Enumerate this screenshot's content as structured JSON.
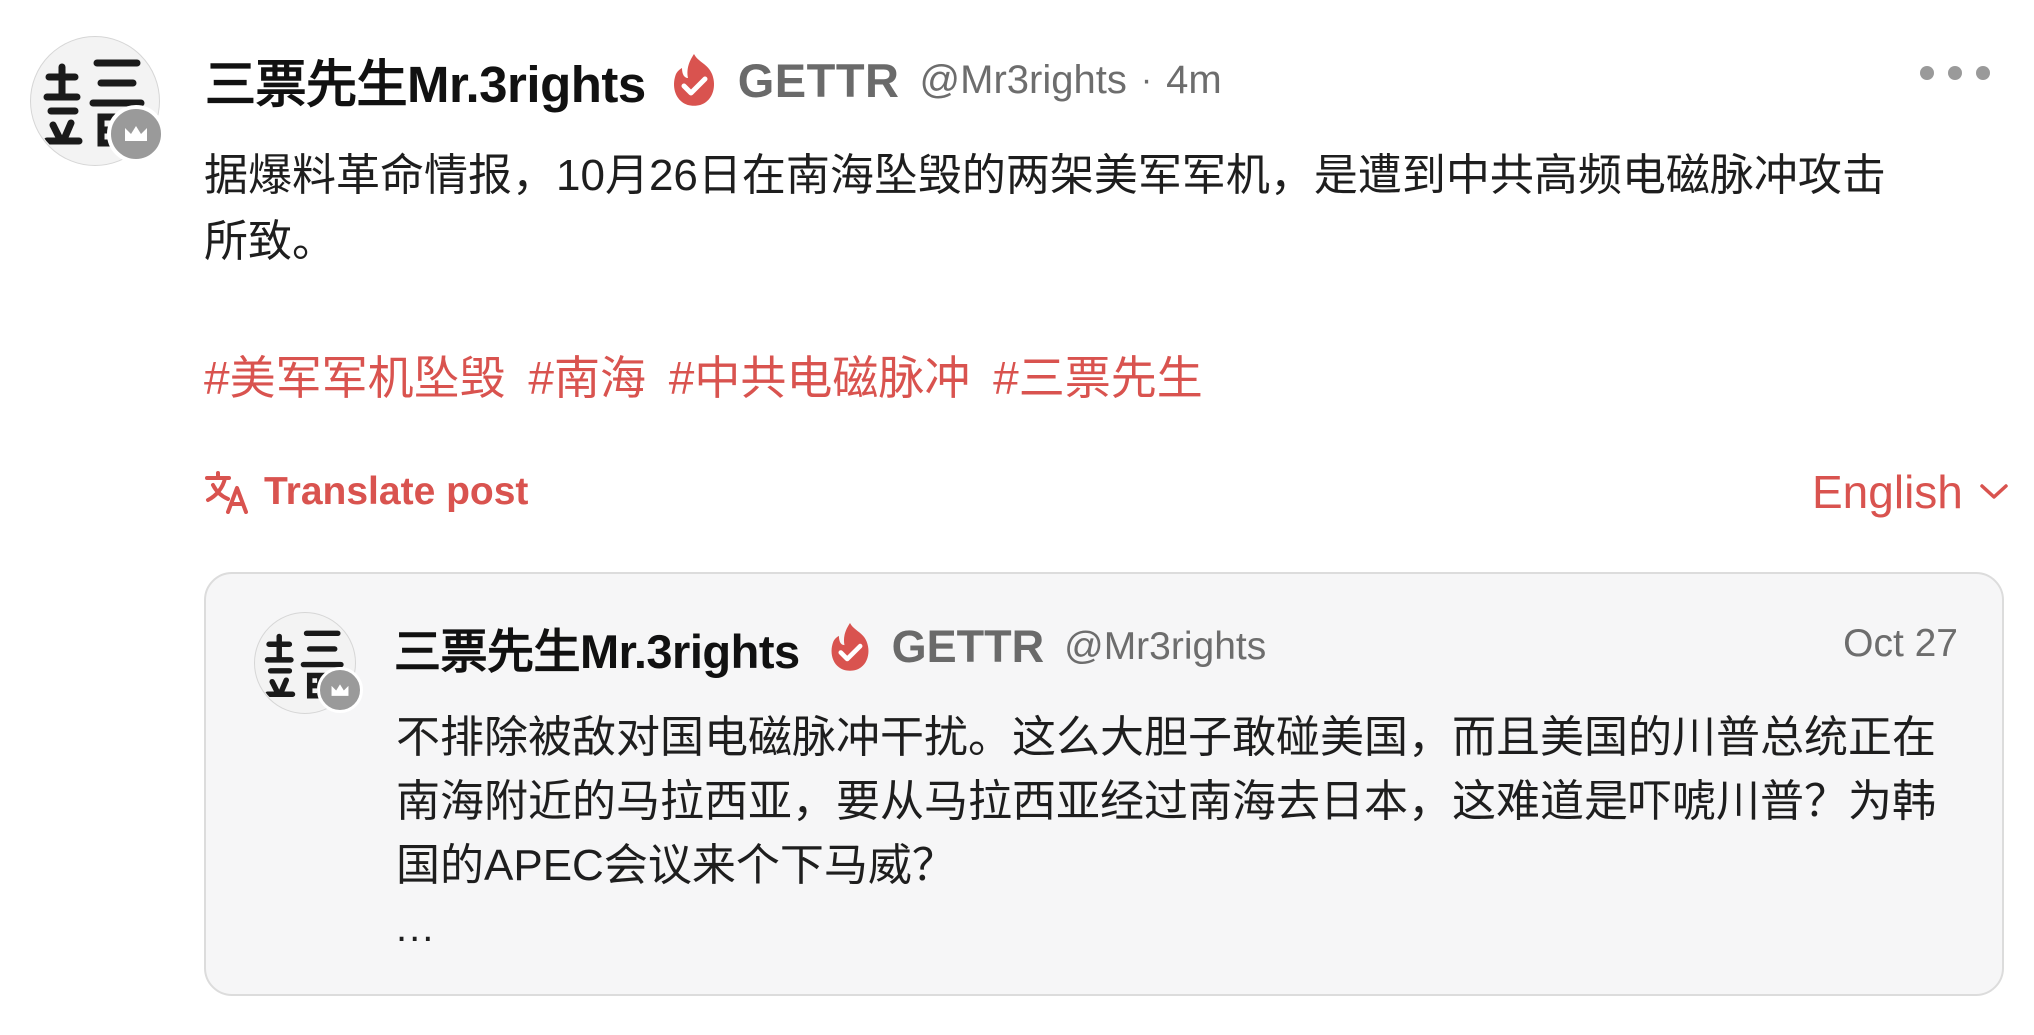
{
  "post": {
    "author": {
      "display_name": "三票先生Mr.3rights",
      "platform_label": "GETTR",
      "handle": "@Mr3rights",
      "verified_icon": "verified-flame-check-icon",
      "avatar": "seal-stamp-avatar",
      "badge_icon": "crown-icon"
    },
    "separator": "·",
    "time": "4m",
    "more_icon": "more-horizontal-icon",
    "text": "据爆料革命情报，10月26日在南海坠毁的两架美军军机，是遭到中共高频电磁脉冲攻击所致。",
    "hashtags": [
      "#美军军机坠毁",
      "#南海",
      "#中共电磁脉冲",
      "#三票先生"
    ],
    "translate": {
      "icon": "translate-icon",
      "label": "Translate post"
    },
    "language": {
      "label": "English",
      "icon": "chevron-down-icon"
    }
  },
  "quoted_post": {
    "author": {
      "display_name": "三票先生Mr.3rights",
      "platform_label": "GETTR",
      "handle": "@Mr3rights"
    },
    "date": "Oct 27",
    "text": "不排除被敌对国电磁脉冲干扰。这么大胆子敢碰美国，而且美国的川普总统正在南海附近的马拉西亚，要从马拉西亚经过南海去日本，这难道是吓唬川普？为韩国的APEC会议来个下马威？",
    "ellipsis": "..."
  },
  "colors": {
    "accent": "#d9534f",
    "muted_text": "#6d6d6d",
    "card_background": "#f6f6f7",
    "card_border": "#dcdcdc"
  }
}
